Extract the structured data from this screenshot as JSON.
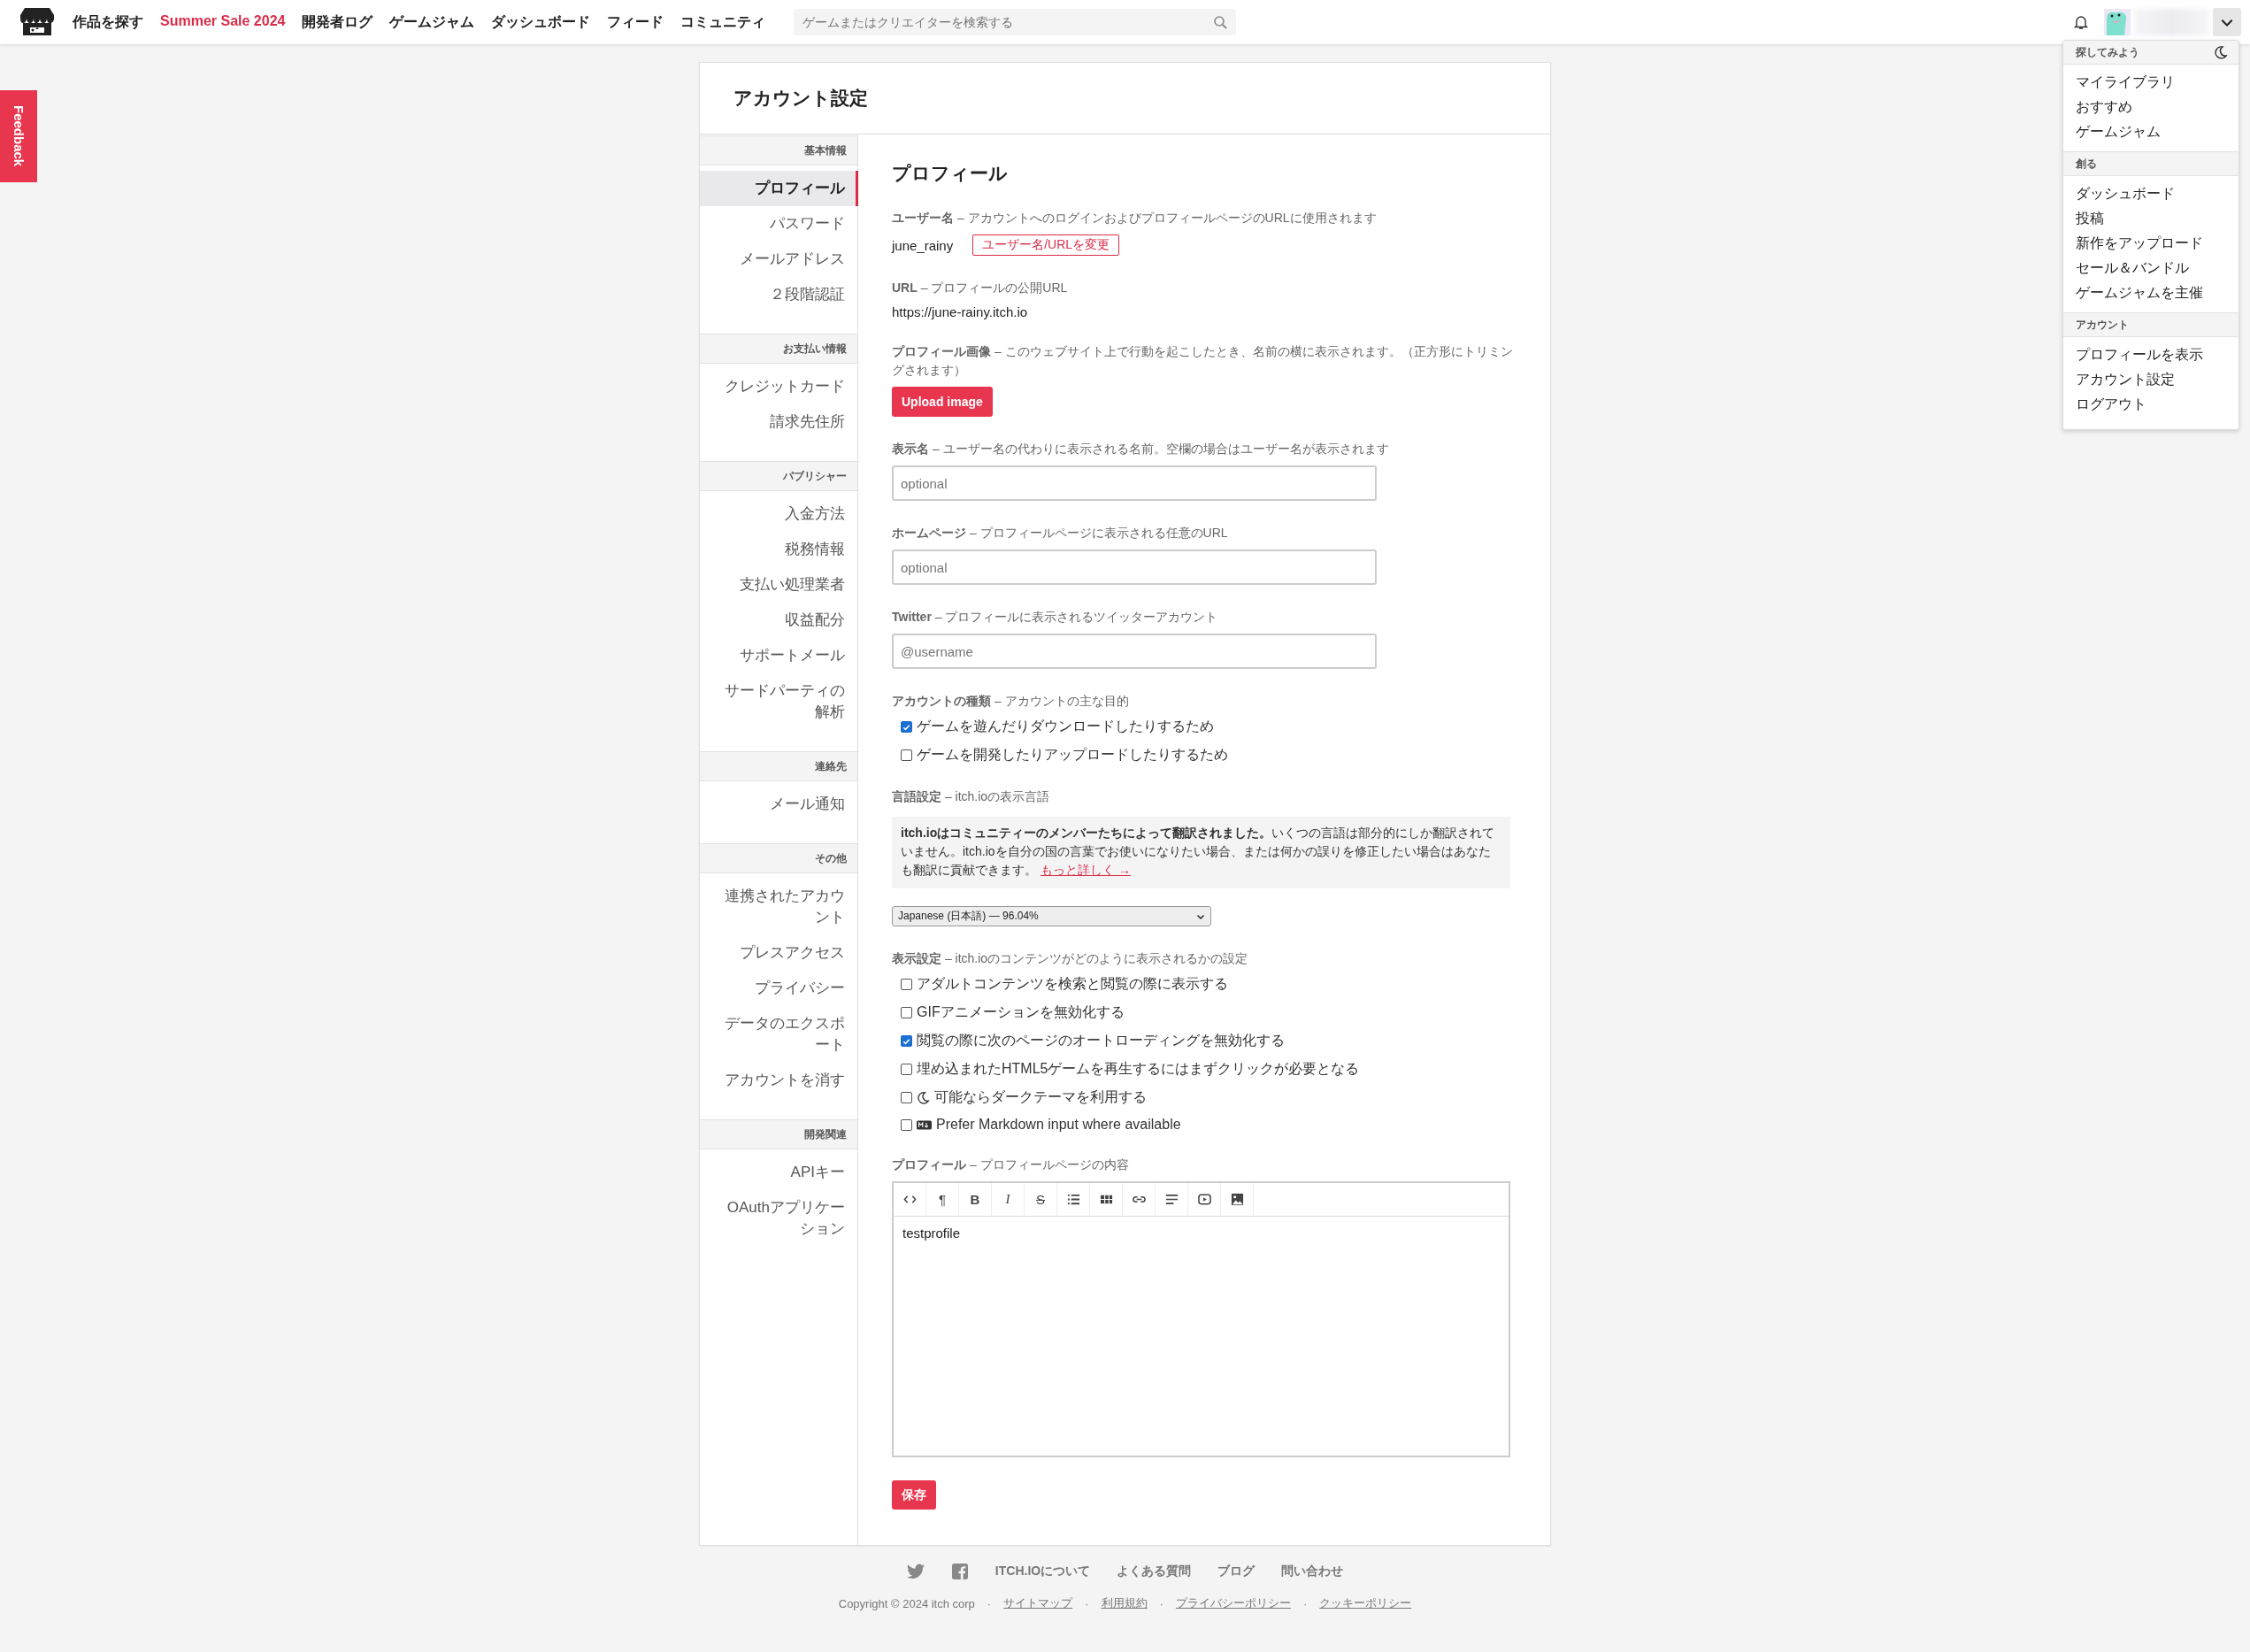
{
  "header": {
    "nav": [
      {
        "label": "作品を探す",
        "highlight": false
      },
      {
        "label": "Summer Sale 2024",
        "highlight": true
      },
      {
        "label": "開発者ログ",
        "highlight": false
      },
      {
        "label": "ゲームジャム",
        "highlight": false
      },
      {
        "label": "ダッシュボード",
        "highlight": false
      },
      {
        "label": "フィード",
        "highlight": false
      },
      {
        "label": "コミュニティ",
        "highlight": false
      }
    ],
    "search": {
      "placeholder": "ゲームまたはクリエイターを検索する"
    }
  },
  "feedback_tab": "Feedback",
  "user_menu": {
    "sections": [
      {
        "title": "探してみよう",
        "items": [
          "マイライブラリ",
          "おすすめ",
          "ゲームジャム"
        ]
      },
      {
        "title": "創る",
        "items": [
          "ダッシュボード",
          "投稿",
          "新作をアップロード",
          "セール＆バンドル",
          "ゲームジャムを主催"
        ]
      },
      {
        "title": "アカウント",
        "items": [
          "プロフィールを表示",
          "アカウント設定",
          "ログアウト"
        ]
      }
    ]
  },
  "page_title": "アカウント設定",
  "sidebar": [
    {
      "heading": "基本情報",
      "items": [
        {
          "label": "プロフィール",
          "selected": true
        },
        {
          "label": "パスワード",
          "selected": false
        },
        {
          "label": "メールアドレス",
          "selected": false
        },
        {
          "label": "２段階認証",
          "selected": false
        }
      ]
    },
    {
      "heading": "お支払い情報",
      "items": [
        {
          "label": "クレジットカード",
          "selected": false
        },
        {
          "label": "請求先住所",
          "selected": false
        }
      ]
    },
    {
      "heading": "パブリシャー",
      "items": [
        {
          "label": "入金方法",
          "selected": false
        },
        {
          "label": "税務情報",
          "selected": false
        },
        {
          "label": "支払い処理業者",
          "selected": false
        },
        {
          "label": "収益配分",
          "selected": false
        },
        {
          "label": "サポートメール",
          "selected": false
        },
        {
          "label": "サードパーティの解析",
          "selected": false
        }
      ]
    },
    {
      "heading": "連絡先",
      "items": [
        {
          "label": "メール通知",
          "selected": false
        }
      ]
    },
    {
      "heading": "その他",
      "items": [
        {
          "label": "連携されたアカウント",
          "selected": false
        },
        {
          "label": "プレスアクセス",
          "selected": false
        },
        {
          "label": "プライバシー",
          "selected": false
        },
        {
          "label": "データのエクスポート",
          "selected": false
        },
        {
          "label": "アカウントを消す",
          "selected": false
        }
      ]
    },
    {
      "heading": "開発関連",
      "items": [
        {
          "label": "APIキー",
          "selected": false
        },
        {
          "label": "OAuthアプリケーション",
          "selected": false
        }
      ]
    }
  ],
  "profile": {
    "title": "プロフィール",
    "username": {
      "desc": "**ユーザー名** – アカウントへのログインおよびプロフィールページのURLに使用されます",
      "value": "june_rainy",
      "button": "ユーザー名/URLを変更"
    },
    "url": {
      "desc": "**URL** – プロフィールの公開URL",
      "value": "https://june-rainy.itch.io"
    },
    "image": {
      "desc": "**プロフィール画像** – このウェブサイト上で行動を起こしたとき、名前の横に表示されます。（正方形にトリミングされます）",
      "button": "Upload image"
    },
    "fields": [
      {
        "desc": "**表示名** – ユーザー名の代わりに表示される名前。空欄の場合はユーザー名が表示されます",
        "placeholder": "optional"
      },
      {
        "desc": "**ホームページ** – プロフィールページに表示される任意のURL",
        "placeholder": "optional"
      },
      {
        "desc": "**Twitter** – プロフィールに表示されるツイッターアカウント",
        "placeholder": "@username"
      }
    ],
    "account_type": {
      "desc": "**アカウントの種類** – アカウントの主な目的",
      "options": [
        {
          "label": "ゲームを遊んだりダウンロードしたりするため",
          "checked": true
        },
        {
          "label": "ゲームを開発したりアップロードしたりするため",
          "checked": false
        }
      ]
    },
    "language": {
      "desc": "**言語設定** – itch.ioの表示言語",
      "notice": "**itch.ioはコミュニティーのメンバーたちによって翻訳されました。**いくつの言語は部分的にしか翻訳されていません。itch.ioを自分の国の言葉でお使いになりたい場合、または何かの誤りを修正したい場合はあなたも翻訳に貢献できます。",
      "link": "もっと詳しく →",
      "value": "Japanese (日本語) — 96.04%"
    },
    "display": {
      "desc": "**表示設定** – itch.ioのコンテンツがどのように表示されるかの設定",
      "options": [
        {
          "kind": "plain",
          "label": "アダルトコンテンツを検索と閲覧の際に表示する",
          "checked": false
        },
        {
          "kind": "plain",
          "label": "GIFアニメーションを無効化する",
          "checked": false
        },
        {
          "kind": "plain",
          "label": "閲覧の際に次のページのオートローディングを無効化する",
          "checked": true
        },
        {
          "kind": "plain",
          "label": "埋め込まれたHTML5ゲームを再生するにはまずクリックが必要となる",
          "checked": false
        },
        {
          "kind": "dark_theme",
          "label": "可能ならダークテーマを利用する",
          "checked": false
        },
        {
          "kind": "markdown",
          "label": "Prefer Markdown input where available",
          "checked": false
        }
      ]
    },
    "editor": {
      "desc": "**プロフィール** – プロフィールページの内容",
      "toolbar": [
        {
          "kind": "code"
        },
        {
          "kind": "glyph",
          "glyph": "¶"
        },
        {
          "kind": "bold",
          "glyph": "B"
        },
        {
          "kind": "italic",
          "glyph": "I"
        },
        {
          "kind": "strike",
          "glyph": "S"
        },
        {
          "kind": "bullets"
        },
        {
          "kind": "table"
        },
        {
          "kind": "link"
        },
        {
          "kind": "align"
        },
        {
          "kind": "video"
        },
        {
          "kind": "image"
        }
      ],
      "value": "testprofile"
    },
    "save": "保存"
  },
  "footer": {
    "links": [
      "ITCH.IOについて",
      "よくある質問",
      "ブログ",
      "問い合わせ"
    ],
    "legal": [
      {
        "kind": "text",
        "label": "Copyright © 2024 itch corp"
      },
      {
        "kind": "sep",
        "label": "·"
      },
      {
        "kind": "link",
        "label": "サイトマップ"
      },
      {
        "kind": "sep",
        "label": "·"
      },
      {
        "kind": "link",
        "label": "利用規約"
      },
      {
        "kind": "sep",
        "label": "·"
      },
      {
        "kind": "link",
        "label": "プライバシーポリシー"
      },
      {
        "kind": "sep",
        "label": "·"
      },
      {
        "kind": "link",
        "label": "クッキーポリシー"
      }
    ]
  }
}
